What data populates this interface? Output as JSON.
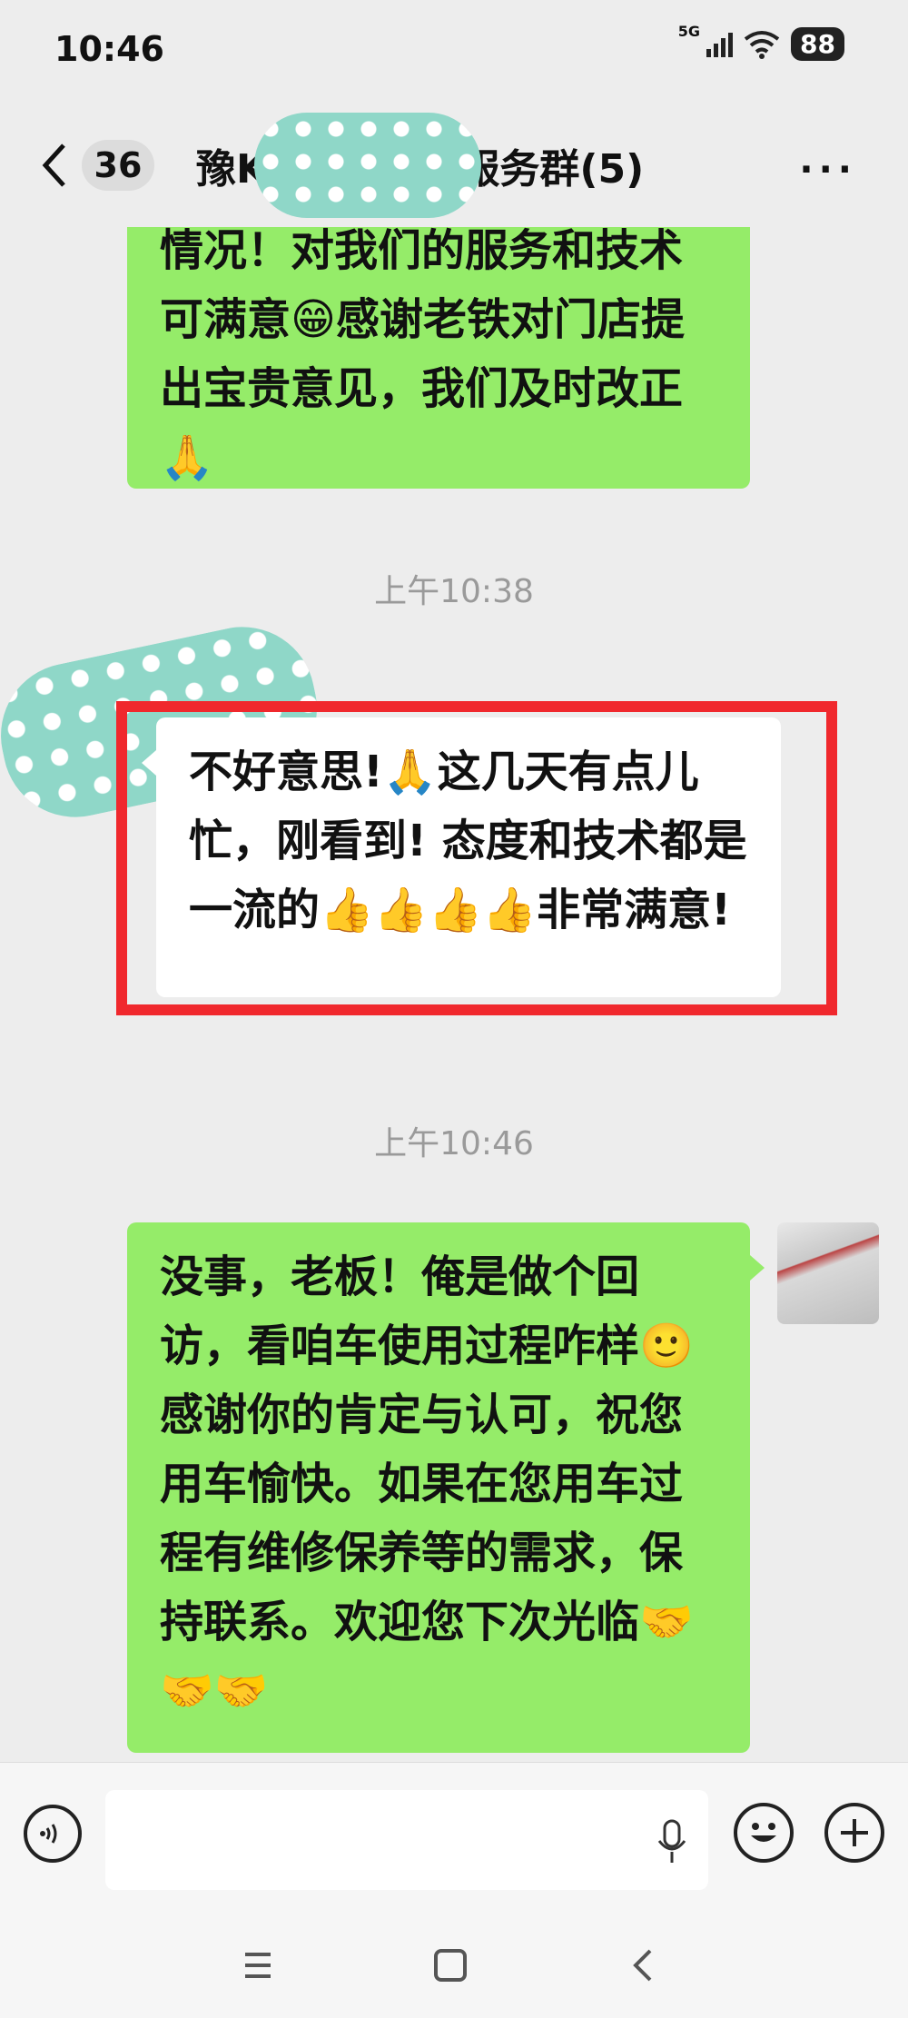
{
  "status_bar": {
    "time": "10:46",
    "network": "5G",
    "battery": "88"
  },
  "header": {
    "unread_count": "36",
    "title_left": "豫K",
    "title_right": "P服务群(5)",
    "more": "···"
  },
  "messages": [
    {
      "side": "right",
      "text": "情况！对我们的服务和技术可满意😁感谢老铁对门店提出宝贵意见，我们及时改正🙏"
    },
    {
      "type": "time",
      "text": "上午10:38"
    },
    {
      "side": "left",
      "highlighted": true,
      "text": "不好意思!🙏这几天有点儿忙，刚看到! 态度和技术都是一流的👍👍👍👍非常满意!"
    },
    {
      "type": "time",
      "text": "上午10:46"
    },
    {
      "side": "right",
      "text": "没事，老板！俺是做个回访，看咱车使用过程咋样🙂感谢你的肯定与认可，祝您用车愉快。如果在您用车过程有维修保养等的需求，保持联系。欢迎您下次光临🤝🤝🤝"
    }
  ],
  "colors": {
    "bubble_self": "#95ec69",
    "bubble_other": "#ffffff",
    "highlight_box": "#f0282d",
    "redaction": "#8fd7c8"
  },
  "icons": [
    "back-arrow-icon",
    "more-icon",
    "voice-icon",
    "mic-icon",
    "emoji-icon",
    "plus-icon",
    "menu-icon",
    "home-icon",
    "nav-back-icon"
  ]
}
